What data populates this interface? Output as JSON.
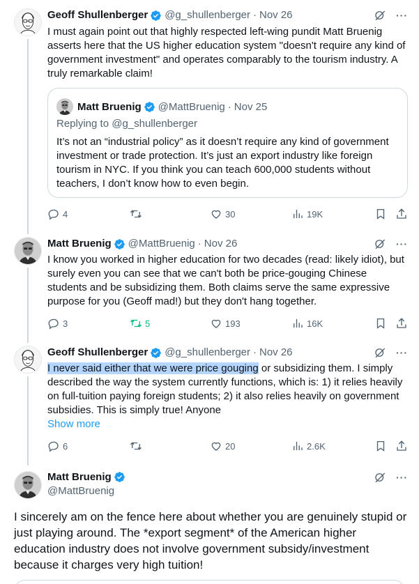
{
  "tweets": [
    {
      "name": "Geoff Shullenberger",
      "handle": "@g_shullenberger",
      "time": "Nov 26",
      "text": "I must again point out that highly respected left-wing pundit Matt Bruenig asserts here that the US higher education system \"doesn't require any kind of government investment\" and operates comparably to the tourism industry. A truly remarkable claim!",
      "quote": {
        "name": "Matt Bruenig",
        "handle": "@MattBruenig",
        "time": "Nov 25",
        "replying": "Replying to @g_shullenberger",
        "text": "It’s not an “industrial policy” as it doesn’t require any kind of government investment or trade protection. It’s just an export industry like foreign tourism in NYC. If you think you can teach 600,000 students without teachers, I don’t know how to even begin."
      },
      "replies": "4",
      "retweets": "",
      "likes": "30",
      "views": "19K"
    },
    {
      "name": "Matt Bruenig",
      "handle": "@MattBruenig",
      "time": "Nov 26",
      "text": "I know you worked in higher education for two decades (read: likely idiot), but surely even you can see that we can't both be price-gouging Chinese students and be subsidizing them. Both claims serve the same expressive purpose for you (Geoff mad!) but they don't hang together.",
      "replies": "3",
      "retweets": "5",
      "likes": "193",
      "views": "16K"
    },
    {
      "name": "Geoff Shullenberger",
      "handle": "@g_shullenberger",
      "time": "Nov 26",
      "text_highlight": "I never said either that we were price gouging",
      "text_rest": " or subsidizing them. I simply described the way the system currently functions, which is: 1) it relies heavily on full-tuition paying foreign students; 2) it also relies heavily on government subsidies. This is simply true! Anyone",
      "show_more": "Show more",
      "replies": "6",
      "retweets": "",
      "likes": "20",
      "views": "2.6K"
    }
  ],
  "main": {
    "name": "Matt Bruenig",
    "handle": "@MattBruenig",
    "text": "I sincerely am on the fence here about whether you are genuinely stupid or just playing around. The *export segment* of the American higher education industry does not involve government subsidy/investment because it charges very high tuition!"
  },
  "colors": {
    "accent": "#1d9bf0",
    "muted": "#536471",
    "retweet_active": "#00ba7c",
    "border": "#cfd9de"
  },
  "icons": [
    "verified-badge-icon",
    "grok-icon",
    "more-icon",
    "reply-icon",
    "retweet-icon",
    "like-icon",
    "views-icon",
    "bookmark-icon",
    "share-icon"
  ]
}
